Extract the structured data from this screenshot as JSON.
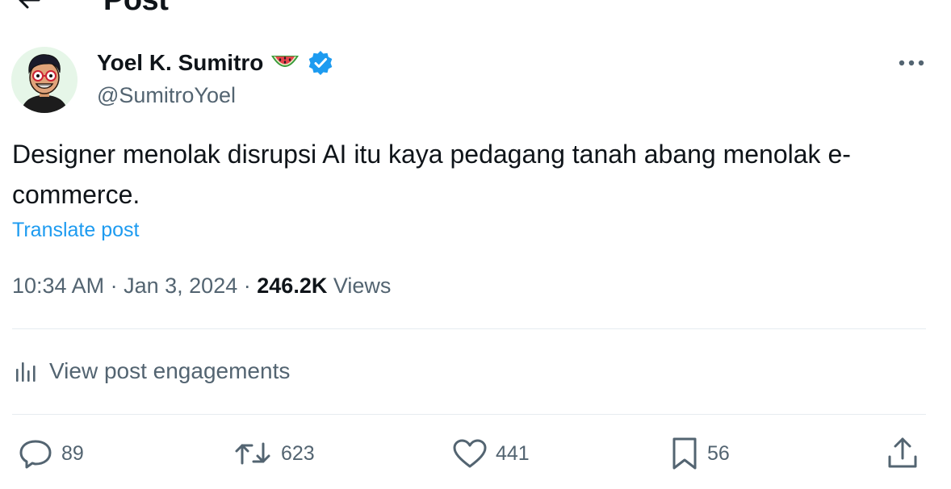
{
  "header": {
    "title": "Post"
  },
  "author": {
    "display_name": "Yoel K. Sumitro",
    "handle": "@SumitroYoel",
    "emoji": "watermelon-icon",
    "verified": true
  },
  "post": {
    "text": "Designer menolak disrupsi AI itu kaya pedagang tanah abang menolak e-commerce.",
    "translate_label": "Translate post"
  },
  "meta": {
    "time": "10:34 AM",
    "separator": "·",
    "date": "Jan 3, 2024",
    "views_count": "246.2K",
    "views_label": "Views"
  },
  "engagements": {
    "label": "View post engagements"
  },
  "actions": {
    "replies": "89",
    "reposts": "623",
    "likes": "441",
    "bookmarks": "56"
  },
  "colors": {
    "accent": "#1d9bf0",
    "secondary_text": "#536471",
    "primary_text": "#0f1419",
    "divider": "#e6ecf0"
  }
}
